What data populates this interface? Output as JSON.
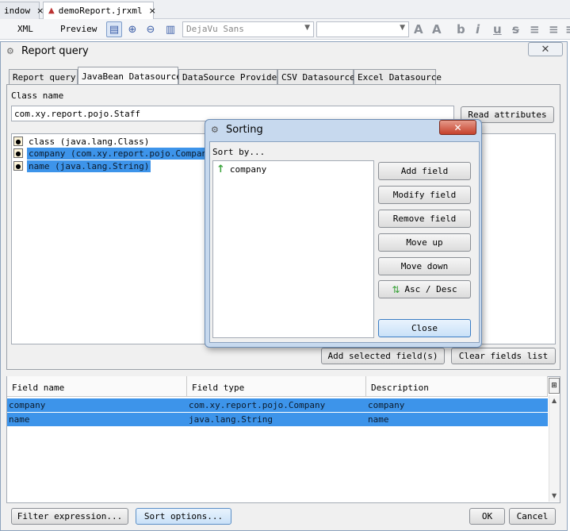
{
  "file_tabs": [
    {
      "label": "indow",
      "close": "×"
    },
    {
      "label": "demoReport.jrxml",
      "close": "×"
    }
  ],
  "toolbar": {
    "xml": "XML",
    "preview": "Preview",
    "font_combo": "DejaVu Sans",
    "size_combo": ""
  },
  "dialog": {
    "title": "Report query",
    "tabs": [
      "Report query",
      "JavaBean Datasource",
      "DataSource Provider",
      "CSV Datasource",
      "Excel Datasource"
    ],
    "active_tab": "JavaBean Datasource",
    "class_name_label": "Class name",
    "class_name_value": "com.xy.report.pojo.Staff",
    "read_attributes": "Read attributes",
    "attributes": [
      {
        "label": "class (java.lang.Class)",
        "selected": false
      },
      {
        "label": "company (com.xy.report.pojo.Company)",
        "selected": true
      },
      {
        "label": "name (java.lang.String)",
        "selected": true
      }
    ],
    "add_selected": "Add selected field(s)",
    "clear_fields": "Clear fields list",
    "table": {
      "headers": [
        "Field name",
        "Field type",
        "Description"
      ],
      "rows": [
        [
          "company",
          "com.xy.report.pojo.Company",
          "company"
        ],
        [
          "name",
          "java.lang.String",
          "name"
        ]
      ]
    },
    "filter_expression": "Filter expression...",
    "sort_options": "Sort options...",
    "ok": "OK",
    "cancel": "Cancel"
  },
  "sorting": {
    "title": "Sorting",
    "sort_by": "Sort by...",
    "items": [
      {
        "label": "company",
        "order": "asc"
      }
    ],
    "buttons": {
      "add": "Add field",
      "modify": "Modify field",
      "remove": "Remove field",
      "up": "Move up",
      "down": "Move down",
      "asc_desc": "Asc / Desc",
      "close": "Close"
    }
  },
  "colors": {
    "selection": "#3d94ea",
    "close_red": "#c5412c",
    "dialog_frame": "#c7d9ee"
  }
}
